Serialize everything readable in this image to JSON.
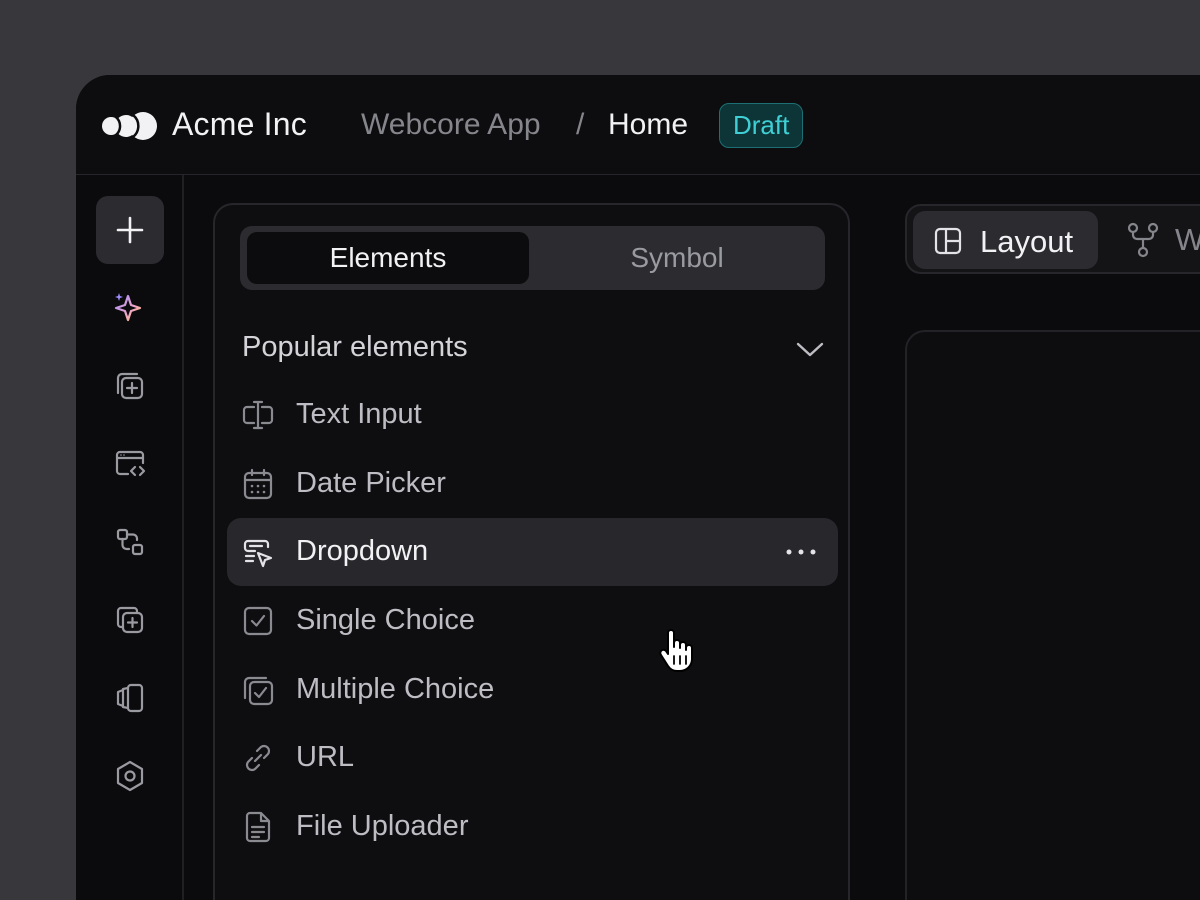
{
  "header": {
    "company": "Acme Inc",
    "breadcrumb_app": "Webcore App",
    "breadcrumb_sep": "/",
    "breadcrumb_page": "Home",
    "status_badge": "Draft"
  },
  "rail": {
    "items": [
      "add",
      "ai-sparkle",
      "add-component",
      "code-window",
      "flow",
      "add-layer",
      "pages",
      "settings"
    ]
  },
  "panel": {
    "tabs": [
      "Elements",
      "Symbol"
    ],
    "active_tab": "Elements",
    "section_title": "Popular elements",
    "items": [
      {
        "label": "Text Input",
        "icon": "text-cursor-icon"
      },
      {
        "label": "Date Picker",
        "icon": "calendar-icon"
      },
      {
        "label": "Dropdown",
        "icon": "dropdown-cursor-icon"
      },
      {
        "label": "Single Choice",
        "icon": "checkbox-icon"
      },
      {
        "label": "Multiple Choice",
        "icon": "multi-checkbox-icon"
      },
      {
        "label": "URL",
        "icon": "link-icon"
      },
      {
        "label": "File Uploader",
        "icon": "file-icon"
      }
    ],
    "hovered_item": "Dropdown"
  },
  "view_switcher": {
    "active": "Layout",
    "second_label_partial": "W"
  },
  "colors": {
    "background": "#38373c",
    "window": "#0b0b0d",
    "badge_text": "#3fd0d6",
    "badge_bg": "#0d3537"
  }
}
